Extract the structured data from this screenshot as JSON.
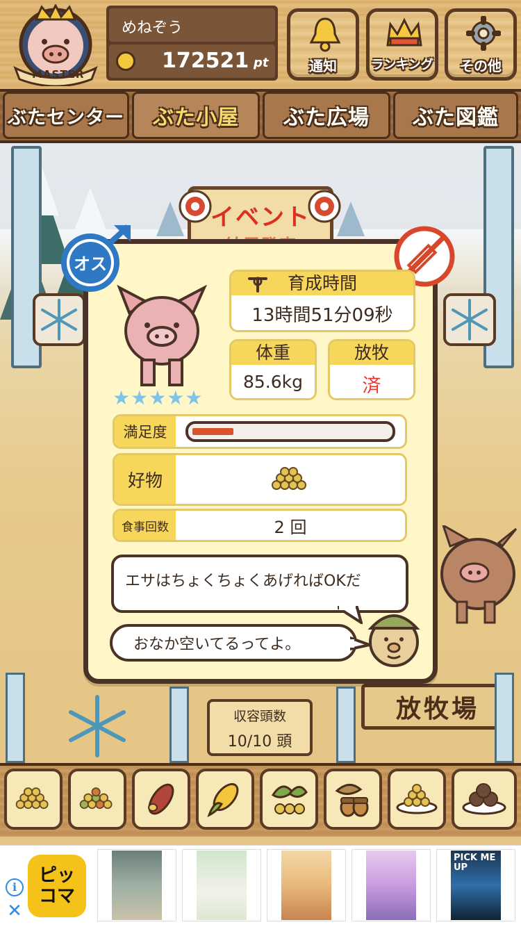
{
  "header": {
    "username": "めねぞう",
    "points_value": "172521",
    "points_unit": "pt",
    "badge_label": "MASTER",
    "buttons": [
      {
        "label": "通知",
        "icon": "bell-icon"
      },
      {
        "label": "ランキング",
        "icon": "crown-icon"
      },
      {
        "label": "その他",
        "icon": "gear-icon"
      }
    ]
  },
  "tabs": [
    {
      "label": "ぶたセンター",
      "active": false
    },
    {
      "label": "ぶた小屋",
      "active": true
    },
    {
      "label": "ぶた広場",
      "active": false
    },
    {
      "label": "ぶた図鑑",
      "active": false
    }
  ],
  "scene": {
    "event_sign": "イベント",
    "event_sign_sub": "結果発表",
    "capacity_title": "収容頭数",
    "capacity_value": "10/10 頭",
    "pasture_sign": "放牧場"
  },
  "pig_card": {
    "gender_label": "オス",
    "rating_stars": "★★★★★",
    "rating_value": 5,
    "raising_time_label": "育成時間",
    "raising_time_value": "13時間51分09秒",
    "weight_label": "体重",
    "weight_value": "85.6kg",
    "grazing_label": "放牧",
    "grazing_value": "済",
    "satisfaction_label": "満足度",
    "satisfaction_level": 0.22,
    "favorite_label": "好物",
    "meals_label": "食事回数",
    "meals_value": "2 回",
    "advice_text": "エサはちょくちょくあげればOKだ",
    "status_text": "おなか空いてるってよ。"
  },
  "food_tray": [
    "grain-pile-icon",
    "mixed-grain-icon",
    "sweet-potato-icon",
    "corn-icon",
    "beans-leaf-icon",
    "acorn-icon",
    "grain-plate-icon",
    "meatball-plate-icon"
  ],
  "ad": {
    "brand_top": "ピッ",
    "brand_bottom": "コマ",
    "info_icon": "info-icon",
    "close_icon": "close-icon",
    "thumb4_label": "PICK ME UP"
  },
  "colors": {
    "wood": "#dcb06f",
    "dark_wood": "#5a3a22",
    "panel": "#fff7c8",
    "accent_yellow": "#f7d65c",
    "male_blue": "#2f78c4",
    "no_red": "#d9472b",
    "done_red": "#e8362a",
    "star_blue": "#7fc4e8",
    "bar_red": "#d9532b"
  }
}
